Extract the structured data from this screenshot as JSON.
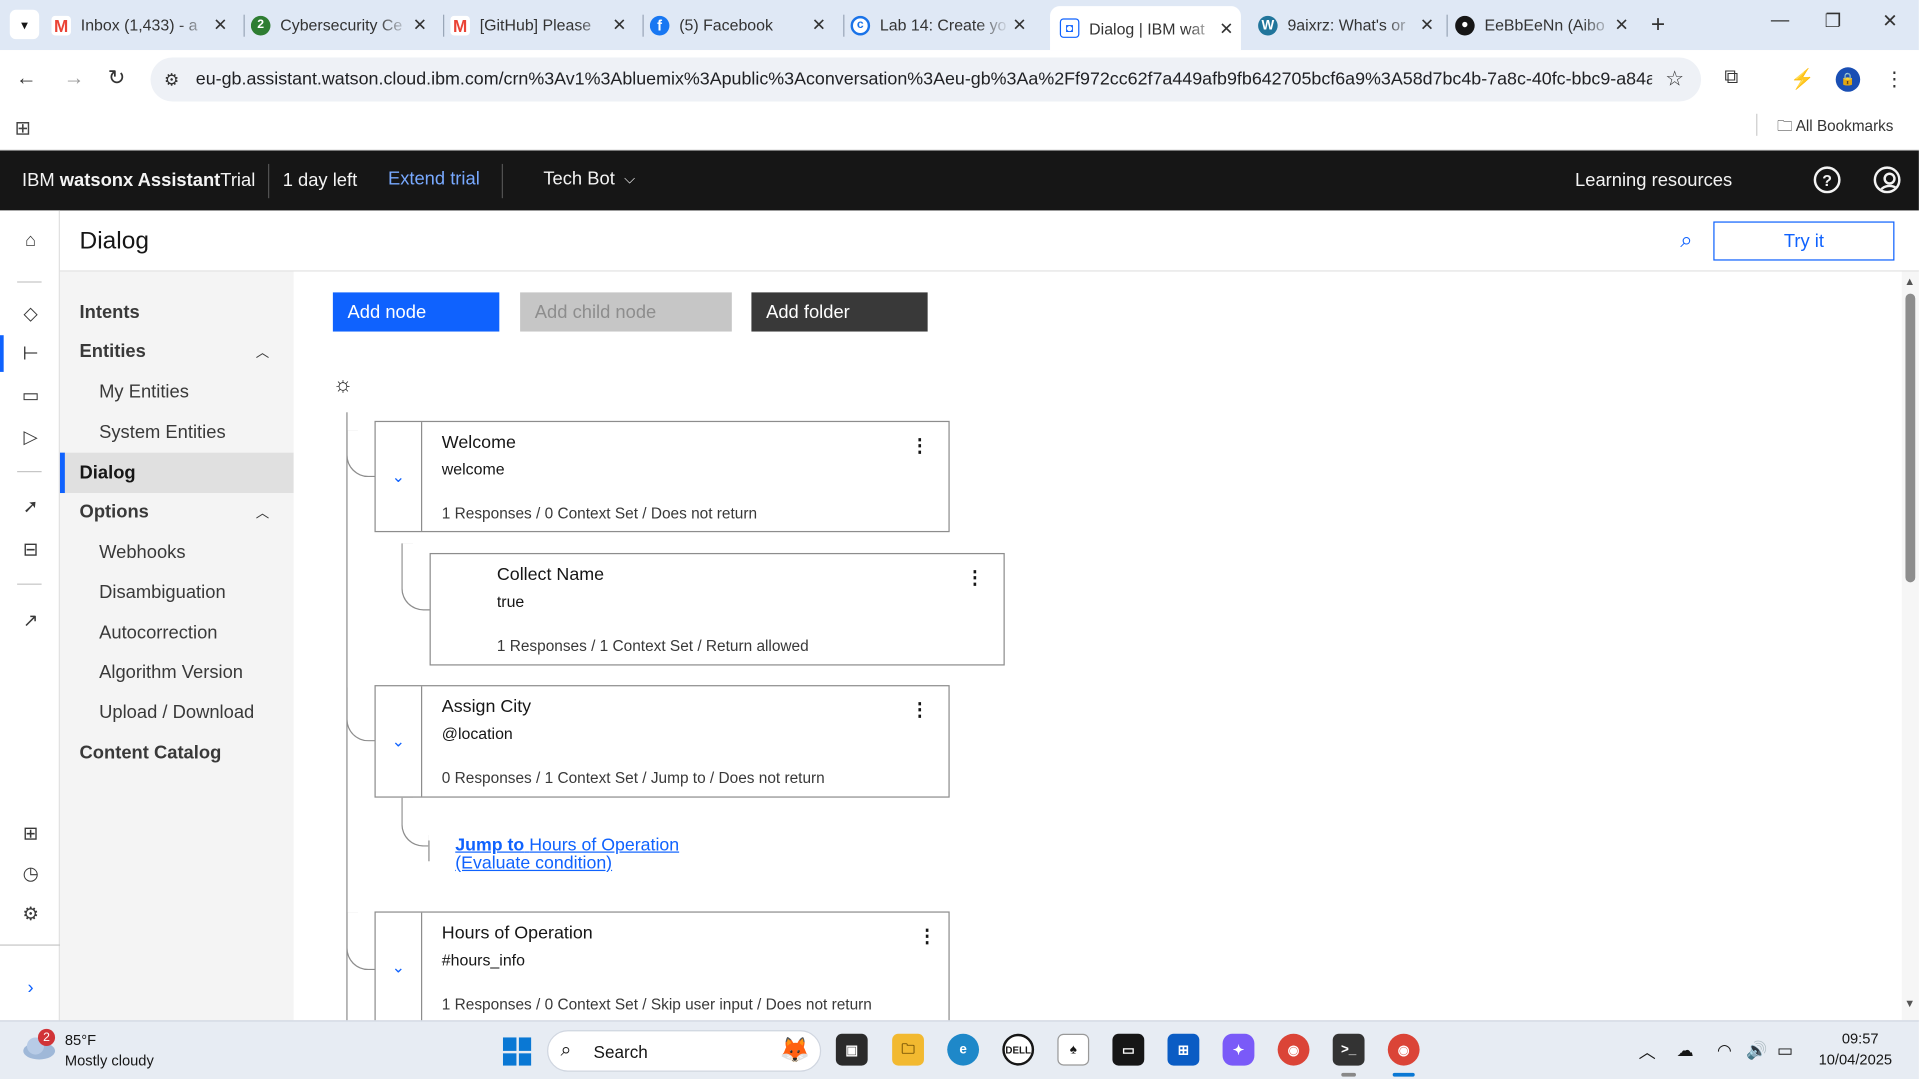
{
  "browser": {
    "tabs": [
      {
        "label": "Inbox (1,433) - a",
        "icon": "gmail-icon",
        "color": "#ea4335"
      },
      {
        "label": "Cybersecurity Ce",
        "icon": "green-2-icon",
        "color": "#2e7d32"
      },
      {
        "label": "[GitHub] Please",
        "icon": "gmail-icon",
        "color": "#ea4335"
      },
      {
        "label": "(5) Facebook",
        "icon": "facebook-icon",
        "color": "#1877f2"
      },
      {
        "label": "Lab 14: Create yo",
        "icon": "circle-c-icon",
        "color": "#1a73e8"
      },
      {
        "label": "Dialog | IBM wat",
        "icon": "watson-icon",
        "color": "#0f62fe"
      },
      {
        "label": "9aixrz: What's or",
        "icon": "wordpress-icon",
        "color": "#21759b"
      },
      {
        "label": "EeBbEeNn (Aibo",
        "icon": "github-icon",
        "color": "#161616"
      }
    ],
    "url": "eu-gb.assistant.watson.cloud.ibm.com/crn%3Av1%3Abluemix%3Apublic%3Aconversation%3Aeu-gb%3Aa%2Ff972cc62f7a449afb9fb642705bcf6a9%3A58d7bc4b-7a8c-40fc-bbc9-a84a87b...",
    "all_bookmarks": "All Bookmarks"
  },
  "header": {
    "product": "IBM",
    "product_bold": "watsonx Assistant",
    "trial": "Trial",
    "days_left": "1 day left",
    "extend": "Extend trial",
    "assistant": "Tech Bot",
    "learning": "Learning resources",
    "help_glyph": "?"
  },
  "page": {
    "title": "Dialog",
    "try_it": "Try it"
  },
  "subnav": {
    "intents": "Intents",
    "entities": "Entities",
    "my_entities": "My Entities",
    "system_entities": "System Entities",
    "dialog": "Dialog",
    "options": "Options",
    "webhooks": "Webhooks",
    "disambiguation": "Disambiguation",
    "autocorrection": "Autocorrection",
    "algorithm": "Algorithm Version",
    "upload": "Upload / Download",
    "catalog": "Content Catalog"
  },
  "toolbar": {
    "add_node": "Add node",
    "add_child": "Add child node",
    "add_folder": "Add folder"
  },
  "nodes": [
    {
      "title": "Welcome",
      "condition": "welcome",
      "summary": "1 Responses / 0 Context Set / Does not return"
    },
    {
      "title": "Collect Name",
      "condition": "true",
      "summary": "1 Responses / 1 Context Set / Return allowed"
    },
    {
      "title": "Assign City",
      "condition": "@location",
      "summary": "0 Responses / 1 Context Set / Jump to / Does not return"
    },
    {
      "title": "Hours of Operation",
      "condition": "#hours_info",
      "summary": "1 Responses / 0 Context Set / Skip user input / Does not return"
    }
  ],
  "jump": {
    "prefix": "Jump to",
    "target": "Hours of Operation",
    "mode": "(Evaluate condition)"
  },
  "taskbar": {
    "weather_badge": "2",
    "temperature": "85°F",
    "condition": "Mostly cloudy",
    "search": "Search",
    "time": "09:57",
    "date": "10/04/2025"
  },
  "colors": {
    "accent": "#0f62fe",
    "header_bg": "#161616",
    "nav_bg": "#f4f4f4",
    "link": "#78a9ff"
  }
}
